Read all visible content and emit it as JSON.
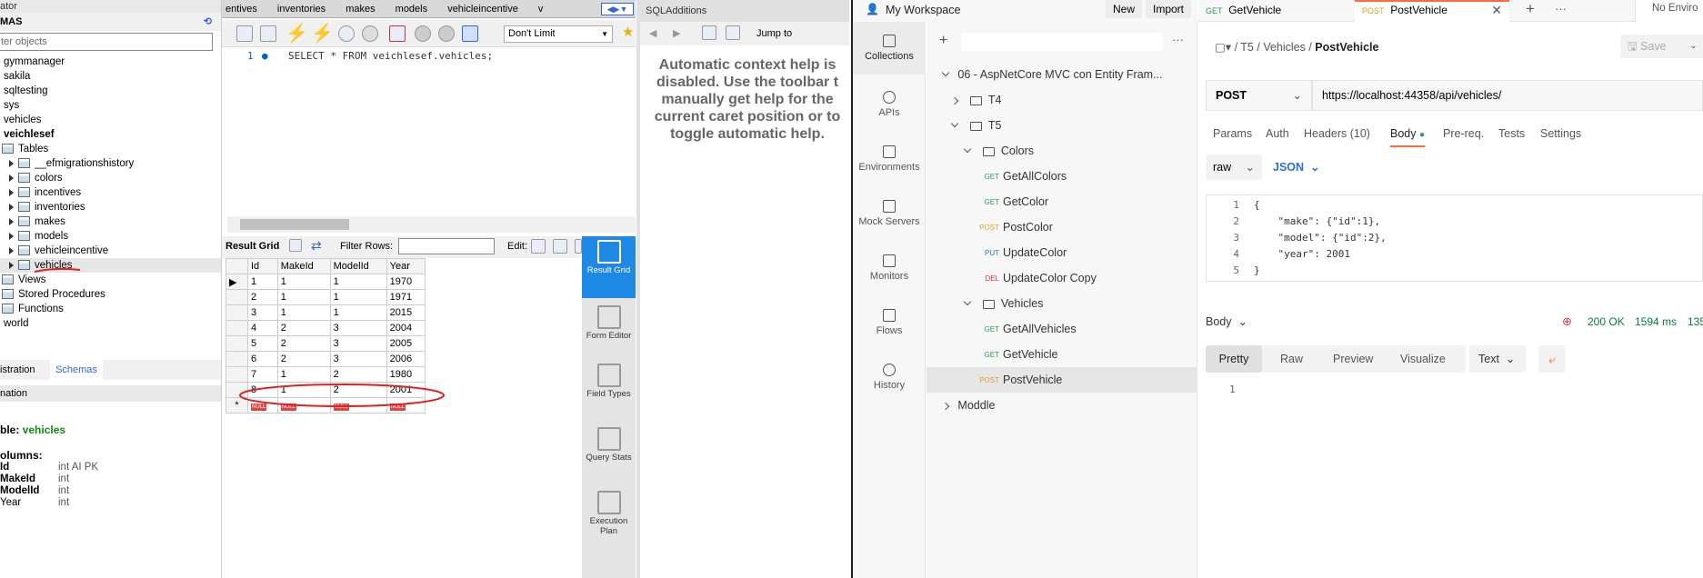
{
  "workbench": {
    "navigator": {
      "header": "ator",
      "title": "MAS",
      "filter_placeholder": "ter objects",
      "schemas": [
        "gymmanager",
        "sakila",
        "sqltesting",
        "sys",
        "vehicles"
      ],
      "active_schema": "veichlesef",
      "tables_label": "Tables",
      "tables": [
        "__efmigrationshistory",
        "colors",
        "incentives",
        "inventories",
        "makes",
        "models",
        "vehicleincentive",
        "vehicles"
      ],
      "views_label": "Views",
      "procedures_label": "Stored Procedures",
      "functions_label": "Functions",
      "world": "world",
      "bottom_tabs": [
        "istration",
        "Schemas"
      ],
      "info_header": "nation",
      "table_label": "ble:",
      "table_name": "vehicles",
      "columns_label": "olumns:",
      "columns": [
        {
          "name": "Id",
          "type": "int AI PK"
        },
        {
          "name": "MakeId",
          "type": "int"
        },
        {
          "name": "ModelId",
          "type": "int"
        },
        {
          "name": "Year",
          "type": "int"
        }
      ]
    },
    "editor_tabs": [
      "entives",
      "inventories",
      "makes",
      "models",
      "vehicleincentive",
      "v"
    ],
    "limit_select": "Don't Limit",
    "sql": {
      "line_no": "1",
      "code": "SELECT * FROM veichlesef.vehicles;"
    },
    "result": {
      "grid_label": "Result Grid",
      "filter_label": "Filter Rows:",
      "edit_label": "Edit:",
      "columns": [
        "Id",
        "MakeId",
        "ModelId",
        "Year"
      ],
      "rows": [
        [
          "1",
          "1",
          "1",
          "1970"
        ],
        [
          "2",
          "1",
          "1",
          "1971"
        ],
        [
          "3",
          "1",
          "1",
          "2015"
        ],
        [
          "4",
          "2",
          "3",
          "2004"
        ],
        [
          "5",
          "2",
          "3",
          "2005"
        ],
        [
          "6",
          "2",
          "3",
          "2006"
        ],
        [
          "7",
          "1",
          "2",
          "1980"
        ],
        [
          "8",
          "1",
          "2",
          "2001"
        ]
      ],
      "null_label": "NULL"
    },
    "side_buttons": [
      "Result Grid",
      "Form Editor",
      "Field Types",
      "Query Stats",
      "Execution Plan"
    ],
    "sql_additions": {
      "title": "SQLAdditions",
      "jump_to": "Jump to",
      "help_lines": [
        "Automatic context help is",
        "disabled. Use the toolbar t",
        "manually get help for the",
        "current caret position or to",
        "toggle automatic help."
      ]
    }
  },
  "postman": {
    "workspace": "My Workspace",
    "new_btn": "New",
    "import_btn": "Import",
    "sidebar": [
      "Collections",
      "APIs",
      "Environments",
      "Mock Servers",
      "Monitors",
      "Flows",
      "History"
    ],
    "tree": {
      "collection": "06 - AspNetCore MVC con Entity Fram...",
      "t4": "T4",
      "t5": "T5",
      "colors": "Colors",
      "color_reqs": [
        {
          "method": "GET",
          "name": "GetAllColors"
        },
        {
          "method": "GET",
          "name": "GetColor"
        },
        {
          "method": "POST",
          "name": "PostColor"
        },
        {
          "method": "PUT",
          "name": "UpdateColor"
        },
        {
          "method": "DEL",
          "name": "UpdateColor Copy"
        }
      ],
      "vehicles": "Vehicles",
      "vehicle_reqs": [
        {
          "method": "GET",
          "name": "GetAllVehicles"
        },
        {
          "method": "GET",
          "name": "GetVehicle"
        },
        {
          "method": "POST",
          "name": "PostVehicle"
        }
      ],
      "moddle": "Moddle"
    },
    "tabs": [
      {
        "method": "GET",
        "name": "GetVehicle"
      },
      {
        "method": "POST",
        "name": "PostVehicle"
      }
    ],
    "env": "No Enviro",
    "breadcrumb": [
      "T5",
      "Vehicles",
      "PostVehicle"
    ],
    "save_btn": "Save",
    "method": "POST",
    "url": "https://localhost:44358/api/vehicles/",
    "req_tabs": [
      "Params",
      "Auth",
      "Headers (10)",
      "Body",
      "Pre-req.",
      "Tests",
      "Settings"
    ],
    "body_mode": "raw",
    "body_type": "JSON",
    "body_lines": [
      "{",
      "    \"make\": {\"id\":1},",
      "    \"model\": {\"id\":2},",
      "    \"year\": 2001",
      "}"
    ],
    "response": {
      "label": "Body",
      "status": "200 OK",
      "time": "1594 ms",
      "size": "135",
      "view_tabs": [
        "Pretty",
        "Raw",
        "Preview",
        "Visualize"
      ],
      "format": "Text",
      "line": "1"
    }
  },
  "colors": {
    "postman_orange": "#ff6c37",
    "status_green": "#097a3a",
    "wb_blue": "#1e88e5"
  }
}
